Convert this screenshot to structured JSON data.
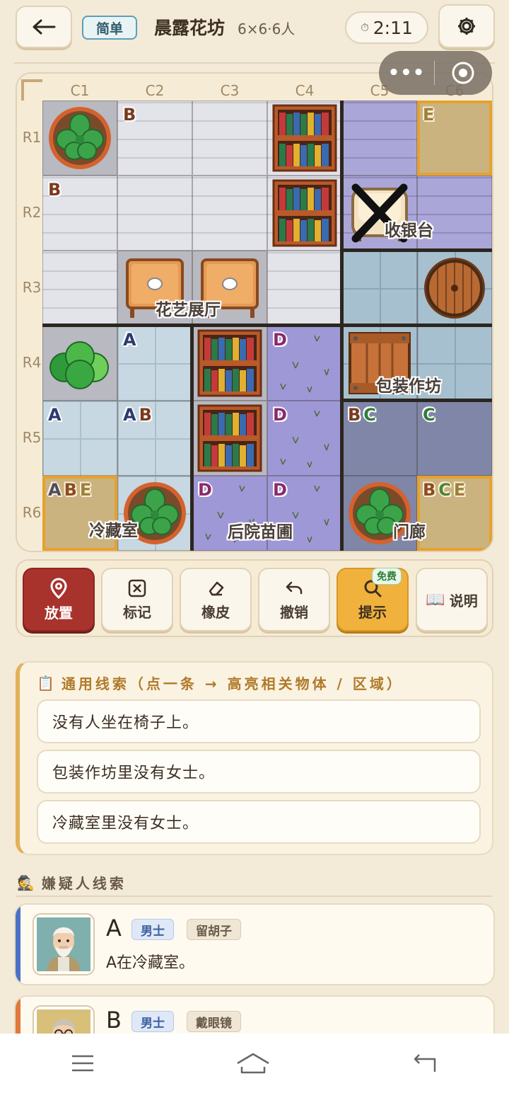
{
  "header": {
    "difficulty": "简单",
    "title": "晨露花坊",
    "subtitle": "6×6·6人",
    "timer": "2:11"
  },
  "board": {
    "columns": [
      "C1",
      "C2",
      "C3",
      "C4",
      "C5",
      "C6"
    ],
    "rows": [
      "R1",
      "R2",
      "R3",
      "R4",
      "R5",
      "R6"
    ],
    "rooms": [
      "花艺展厅",
      "收银台",
      "包装作坊",
      "冷藏室",
      "后院苗圃",
      "门廊"
    ],
    "cells": [
      {
        "r": 1,
        "c": 1,
        "letters": "",
        "object": "plant",
        "floor": "gray"
      },
      {
        "r": 1,
        "c": 2,
        "letters": "B",
        "object": "",
        "floor": "wood"
      },
      {
        "r": 1,
        "c": 3,
        "letters": "",
        "object": "",
        "floor": "wood"
      },
      {
        "r": 1,
        "c": 4,
        "letters": "",
        "object": "bookshelf",
        "floor": "wood"
      },
      {
        "r": 1,
        "c": 5,
        "letters": "",
        "object": "",
        "floor": "lav"
      },
      {
        "r": 1,
        "c": 6,
        "letters": "E",
        "object": "",
        "floor": "sand",
        "highlight": true
      },
      {
        "r": 2,
        "c": 1,
        "letters": "B",
        "object": "",
        "floor": "wood"
      },
      {
        "r": 2,
        "c": 2,
        "letters": "",
        "object": "",
        "floor": "wood"
      },
      {
        "r": 2,
        "c": 3,
        "letters": "",
        "object": "",
        "floor": "wood"
      },
      {
        "r": 2,
        "c": 4,
        "letters": "",
        "object": "bookshelf",
        "floor": "wood"
      },
      {
        "r": 2,
        "c": 5,
        "letters": "",
        "object": "chair-x",
        "floor": "lav"
      },
      {
        "r": 2,
        "c": 6,
        "letters": "",
        "object": "",
        "floor": "lav"
      },
      {
        "r": 3,
        "c": 1,
        "letters": "",
        "object": "",
        "floor": "wood"
      },
      {
        "r": 3,
        "c": 2,
        "letters": "",
        "object": "table",
        "floor": "gray"
      },
      {
        "r": 3,
        "c": 3,
        "letters": "",
        "object": "table",
        "floor": "gray"
      },
      {
        "r": 3,
        "c": 4,
        "letters": "",
        "object": "",
        "floor": "wood"
      },
      {
        "r": 3,
        "c": 5,
        "letters": "",
        "object": "",
        "floor": "tileblue"
      },
      {
        "r": 3,
        "c": 6,
        "letters": "",
        "object": "barrel",
        "floor": "tileblue"
      },
      {
        "r": 4,
        "c": 1,
        "letters": "",
        "object": "bush",
        "floor": "gray"
      },
      {
        "r": 4,
        "c": 2,
        "letters": "A",
        "object": "",
        "floor": "ice"
      },
      {
        "r": 4,
        "c": 3,
        "letters": "",
        "object": "bookshelf",
        "floor": "gray"
      },
      {
        "r": 4,
        "c": 4,
        "letters": "D",
        "object": "",
        "floor": "grass"
      },
      {
        "r": 4,
        "c": 5,
        "letters": "",
        "object": "crate",
        "floor": "tileblue"
      },
      {
        "r": 4,
        "c": 6,
        "letters": "",
        "object": "",
        "floor": "tileblue"
      },
      {
        "r": 5,
        "c": 1,
        "letters": "A",
        "object": "",
        "floor": "ice"
      },
      {
        "r": 5,
        "c": 2,
        "letters": "AB",
        "object": "",
        "floor": "ice"
      },
      {
        "r": 5,
        "c": 3,
        "letters": "",
        "object": "bookshelf",
        "floor": "gray"
      },
      {
        "r": 5,
        "c": 4,
        "letters": "D",
        "object": "",
        "floor": "grass"
      },
      {
        "r": 5,
        "c": 5,
        "letters": "BC",
        "object": "",
        "floor": "stone"
      },
      {
        "r": 5,
        "c": 6,
        "letters": "C",
        "object": "",
        "floor": "stone"
      },
      {
        "r": 6,
        "c": 1,
        "letters": "ABE",
        "object": "",
        "floor": "sand",
        "highlight": true
      },
      {
        "r": 6,
        "c": 2,
        "letters": "",
        "object": "plant",
        "floor": "ice"
      },
      {
        "r": 6,
        "c": 3,
        "letters": "D",
        "object": "",
        "floor": "grass"
      },
      {
        "r": 6,
        "c": 4,
        "letters": "D",
        "object": "",
        "floor": "grass"
      },
      {
        "r": 6,
        "c": 5,
        "letters": "",
        "object": "plant",
        "floor": "stone"
      },
      {
        "r": 6,
        "c": 6,
        "letters": "BCE",
        "object": "",
        "floor": "sand",
        "highlight": true
      }
    ]
  },
  "toolbar": {
    "place": "放置",
    "mark": "标记",
    "eraser": "橡皮",
    "undo": "撤销",
    "hint": "提示",
    "hint_badge": "免费",
    "help": "说明"
  },
  "clues": {
    "title": "通用线索（点一条 → 高亮相关物体 / 区域）",
    "items": [
      "没有人坐在椅子上。",
      "包装作坊里没有女士。",
      "冷藏室里没有女士。"
    ]
  },
  "suspects": {
    "title": "嫌疑人线索",
    "list": [
      {
        "id": "A",
        "gender": "男士",
        "trait": "留胡子",
        "clue": "A在冷藏室。",
        "stripe": "#4a72c4"
      },
      {
        "id": "B",
        "gender": "男士",
        "trait": "戴眼镜",
        "clue": "",
        "stripe": "#e07a3a"
      }
    ]
  },
  "colors": {
    "accent_red": "#a8332d",
    "hint_gold": "#f0b23c",
    "highlight_orange": "#e7a12c"
  },
  "letter_colors": {
    "A": "#2d3a6e",
    "B": "#7a3a1e",
    "C": "#2f7d3a",
    "D": "#8a2a6a",
    "E": "#8a7a3a"
  }
}
